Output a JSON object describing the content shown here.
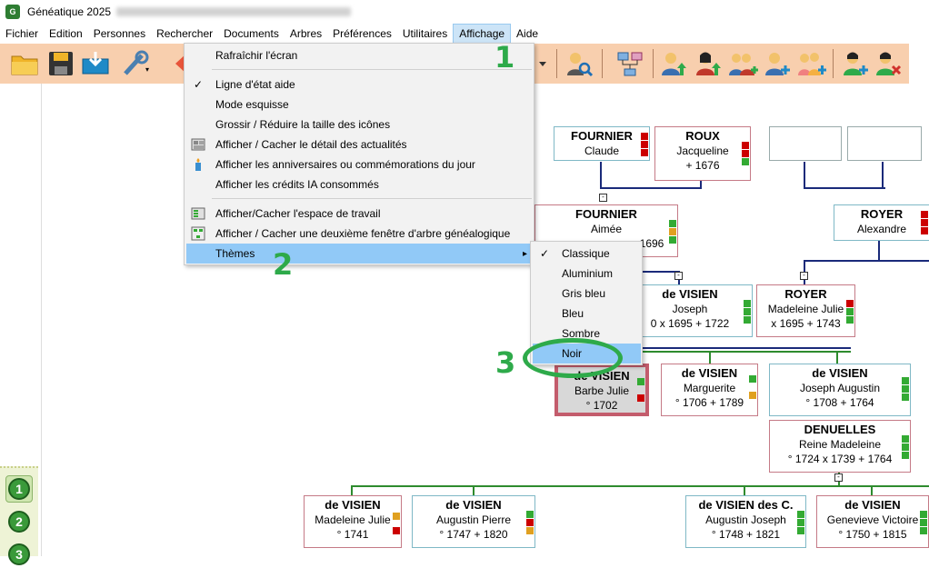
{
  "titlebar": {
    "app_name": "Généatique 2025"
  },
  "menubar": [
    "Fichier",
    "Edition",
    "Personnes",
    "Rechercher",
    "Documents",
    "Arbres",
    "Préférences",
    "Utilitaires",
    "Affichage",
    "Aide"
  ],
  "affichage_menu": {
    "items": [
      "Rafraîchir l'écran",
      "Ligne d'état aide",
      "Mode esquisse",
      "Grossir / Réduire la taille des icônes",
      "Afficher / Cacher le détail des actualités",
      "Afficher les anniversaires ou commémorations du jour",
      "Afficher les crédits IA consommés",
      "Afficher/Cacher l'espace de travail",
      "Afficher / Cacher une deuxième fenêtre d'arbre généalogique",
      "Thèmes"
    ],
    "arrow": "▸"
  },
  "themes_menu": {
    "items": [
      "Classique",
      "Aluminium",
      "Gris bleu",
      "Bleu",
      "Sombre",
      "Noir"
    ]
  },
  "check": "✓",
  "steps": [
    "1",
    "2",
    "3"
  ],
  "generations": [
    "1",
    "2",
    "3"
  ],
  "cards": [
    {
      "id": "fournier-claude",
      "name": "FOURNIER",
      "given": "Claude",
      "dates": ""
    },
    {
      "id": "roux-jacqueline",
      "name": "ROUX",
      "given": "Jacqueline",
      "dates": "+ 1676"
    },
    {
      "id": "fournier-aimee",
      "name": "FOURNIER",
      "given": "Aimée",
      "dates": "1696"
    },
    {
      "id": "royer-alexandre",
      "name": "ROYER",
      "given": "Alexandre",
      "dates": ""
    },
    {
      "id": "devisien-joseph",
      "name": "de VISIEN",
      "given": "Joseph",
      "dates": "0   x 1695   + 1722"
    },
    {
      "id": "royer-madeleine",
      "name": "ROYER",
      "given": "Madeleine Julie",
      "dates": "x 1695   + 1743"
    },
    {
      "id": "devisien-barbe",
      "name": "de VISIEN",
      "given": "Barbe Julie",
      "dates": "° 1702"
    },
    {
      "id": "devisien-marguerite",
      "name": "de VISIEN",
      "given": "Marguerite",
      "dates": "° 1706   + 1789"
    },
    {
      "id": "devisien-josephaug",
      "name": "de VISIEN",
      "given": "Joseph Augustin",
      "dates": "° 1708   + 1764"
    },
    {
      "id": "denuelles-reine",
      "name": "DENUELLES",
      "given": "Reine Madeleine",
      "dates": "° 1724   x 1739   + 1764"
    },
    {
      "id": "devisien-madeleine",
      "name": "de VISIEN",
      "given": "Madeleine Julie",
      "dates": "° 1741"
    },
    {
      "id": "devisien-augustin",
      "name": "de VISIEN",
      "given": "Augustin Pierre",
      "dates": "° 1747   + 1820"
    },
    {
      "id": "devisien-augjoseph",
      "name": "de VISIEN des C.",
      "given": "Augustin Joseph",
      "dates": "° 1748   + 1821"
    },
    {
      "id": "devisien-genevieve",
      "name": "de VISIEN",
      "given": "Genevieve Victoire",
      "dates": "° 1750   + 1815"
    }
  ],
  "colors": {
    "toolbar": "#f8cfae",
    "highlight": "#91c9f7",
    "accent": "#2eaa4a",
    "male_border": "#7fb8c6",
    "female_border": "#c57a86"
  }
}
